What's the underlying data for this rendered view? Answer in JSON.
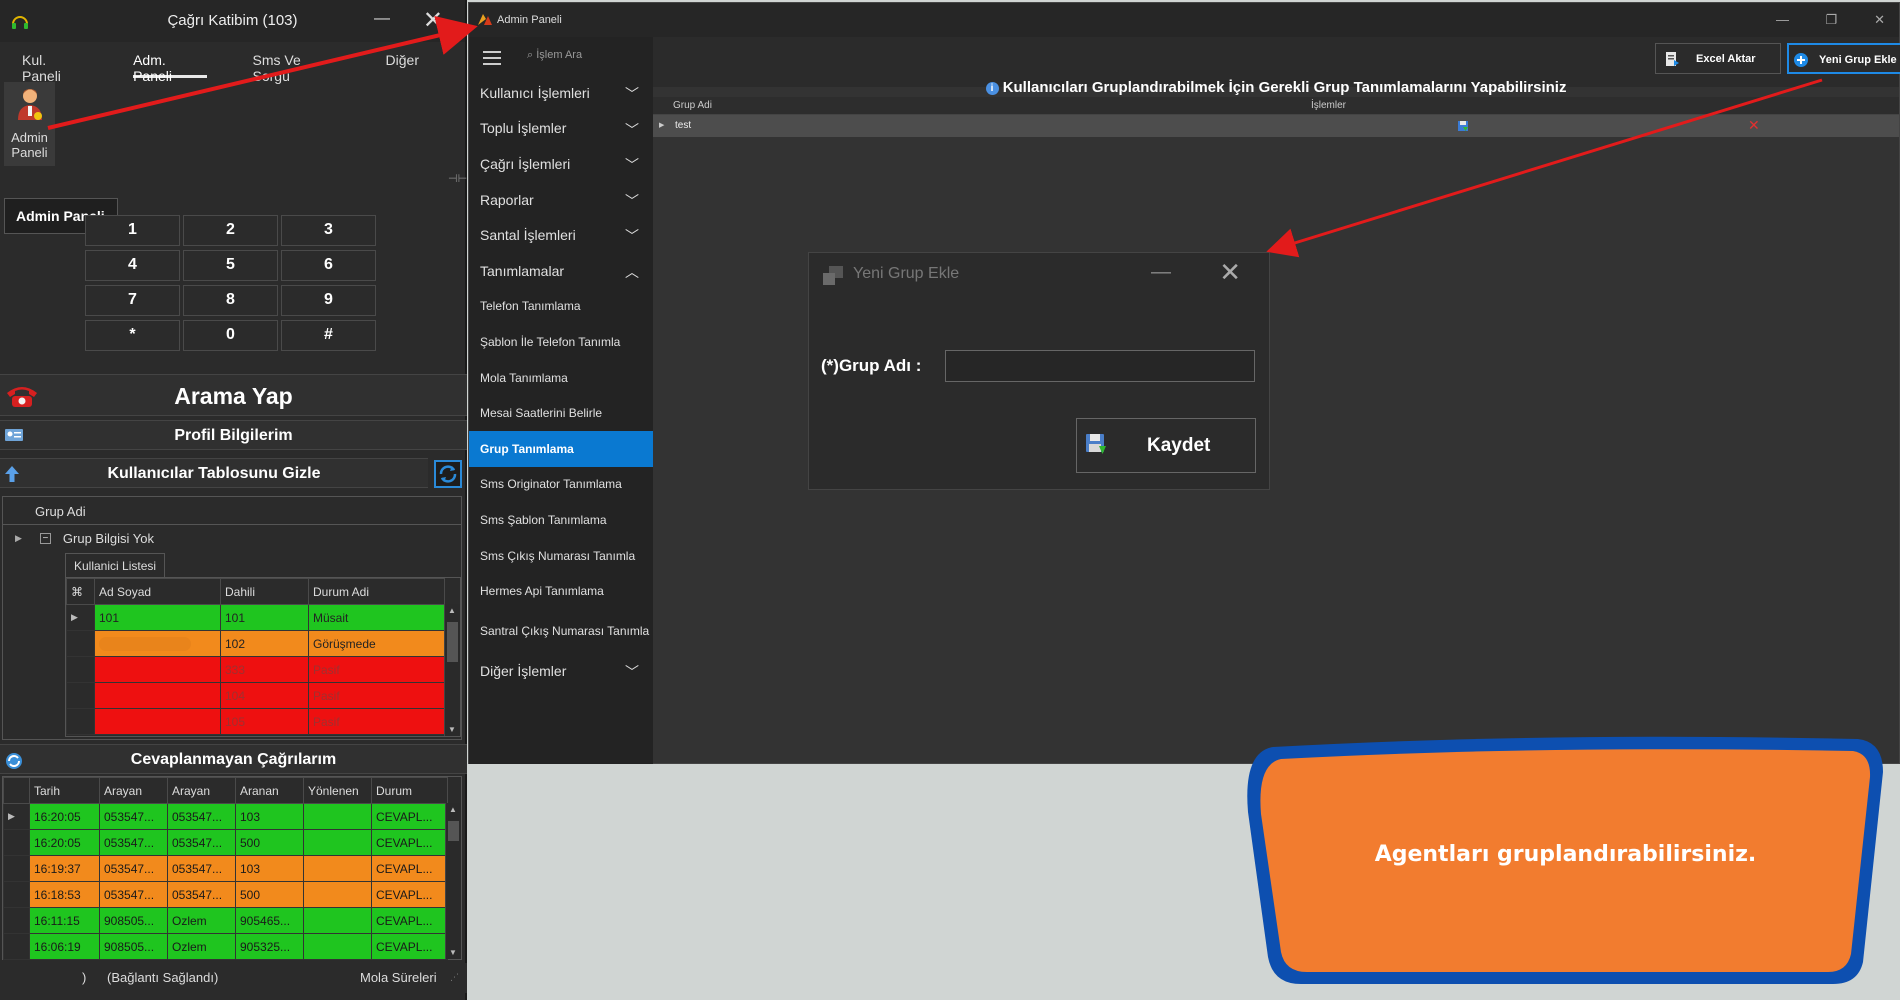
{
  "left_window": {
    "title": "Çağrı Katibim (103)",
    "tabs": [
      "Kul. Paneli",
      "Adm. Paneli",
      "Sms Ve Sorgu",
      "Diğer"
    ],
    "admin_tile_label": "Admin Paneli",
    "tooltip": "Admin Paneli",
    "keypad": [
      "1",
      "2",
      "3",
      "4",
      "5",
      "6",
      "7",
      "8",
      "9",
      "*",
      "0",
      "#"
    ],
    "call_button": "Arama Yap",
    "profile_button": "Profil Bilgilerim",
    "users_toggle": "Kullanıcılar Tablosunu Gizle",
    "group_grid": {
      "header": "Grup Adi",
      "group_row": "Grup Bilgisi Yok",
      "subtab": "Kullanici Listesi",
      "columns": [
        "Ad Soyad",
        "Dahili",
        "Durum Adi"
      ],
      "rows": [
        {
          "name": "101",
          "ext": "101",
          "status": "Müsait",
          "color": "#1fc51f"
        },
        {
          "name": "",
          "ext": "102",
          "status": "Görüşmede",
          "color": "#f28a1c"
        },
        {
          "name": "",
          "ext": "333",
          "status": "Pasif",
          "color": "#ee1010"
        },
        {
          "name": "",
          "ext": "104",
          "status": "Pasif",
          "color": "#ee1010"
        },
        {
          "name": "",
          "ext": "105",
          "status": "Pasif",
          "color": "#ee1010"
        }
      ]
    },
    "missed_calls_title": "Cevaplanmayan Çağrılarım",
    "calls_grid": {
      "columns": [
        "Tarih",
        "Arayan",
        "Arayan",
        "Aranan",
        "Yönlenen",
        "Durum"
      ],
      "rows": [
        {
          "cells": [
            "16:20:05",
            "053547...",
            "053547...",
            "103",
            "",
            "CEVAPL..."
          ],
          "color": "#1fc51f"
        },
        {
          "cells": [
            "16:20:05",
            "053547...",
            "053547...",
            "500",
            "",
            "CEVAPL..."
          ],
          "color": "#1fc51f"
        },
        {
          "cells": [
            "16:19:37",
            "053547...",
            "053547...",
            "103",
            "",
            "CEVAPL..."
          ],
          "color": "#f28a1c"
        },
        {
          "cells": [
            "16:18:53",
            "053547...",
            "053547...",
            "500",
            "",
            "CEVAPL..."
          ],
          "color": "#f28a1c"
        },
        {
          "cells": [
            "16:11:15",
            "908505...",
            "Ozlem",
            "905465...",
            "",
            "CEVAPL..."
          ],
          "color": "#1fc51f"
        },
        {
          "cells": [
            "16:06:19",
            "908505...",
            "Ozlem",
            "905325...",
            "",
            "CEVAPL..."
          ],
          "color": "#1fc51f"
        }
      ]
    },
    "status": {
      "paren": ")",
      "connection": "(Bağlantı Sağlandı)",
      "break_times": "Mola Süreleri"
    }
  },
  "right_window": {
    "title": "Admin Paneli",
    "search_placeholder": "İşlem Ara",
    "menu": [
      {
        "label": "Kullanıcı İşlemleri",
        "chevron": "down"
      },
      {
        "label": "Toplu İşlemler",
        "chevron": "down"
      },
      {
        "label": "Çağrı İşlemleri",
        "chevron": "down"
      },
      {
        "label": "Raporlar",
        "chevron": "down"
      },
      {
        "label": "Santal İşlemleri",
        "chevron": "down"
      },
      {
        "label": "Tanımlamalar",
        "chevron": "up"
      }
    ],
    "submenu": [
      {
        "label": "Telefon Tanımlama"
      },
      {
        "label": "Şablon İle Telefon Tanımla"
      },
      {
        "label": "Mola Tanımlama"
      },
      {
        "label": "Mesai Saatlerini Belirle"
      },
      {
        "label": "Grup Tanımlama",
        "active": true
      },
      {
        "label": "Sms Originator Tanımlama"
      },
      {
        "label": "Sms Şablon Tanımlama"
      },
      {
        "label": "Sms Çıkış Numarası Tanımla"
      },
      {
        "label": "Hermes Api Tanımlama"
      },
      {
        "label": "Santral Çıkış Numarası Tanımla"
      }
    ],
    "other_menu": "Diğer İşlemler",
    "toolbar": {
      "excel": "Excel Aktar",
      "new_group": "Yeni Grup Ekle"
    },
    "heading": "Kullanıcıları Gruplandırabilmek İçin Gerekli Grup Tanımlamalarını Yapabilirsiniz",
    "grid": {
      "col_group": "Grup Adi",
      "col_ops": "İşlemler",
      "rows": [
        {
          "name": "test"
        }
      ]
    }
  },
  "dialog": {
    "title": "Yeni Grup Ekle",
    "label": "(*)Grup Adı :",
    "input_value": "",
    "save": "Kaydet"
  },
  "callout": {
    "text": "Agentları gruplandırabilirsiniz.",
    "fill": "#f27c2f",
    "border": "#0d4fb0"
  },
  "colors": {
    "accent": "#0a79d1",
    "arrow": "#e21b1b"
  }
}
